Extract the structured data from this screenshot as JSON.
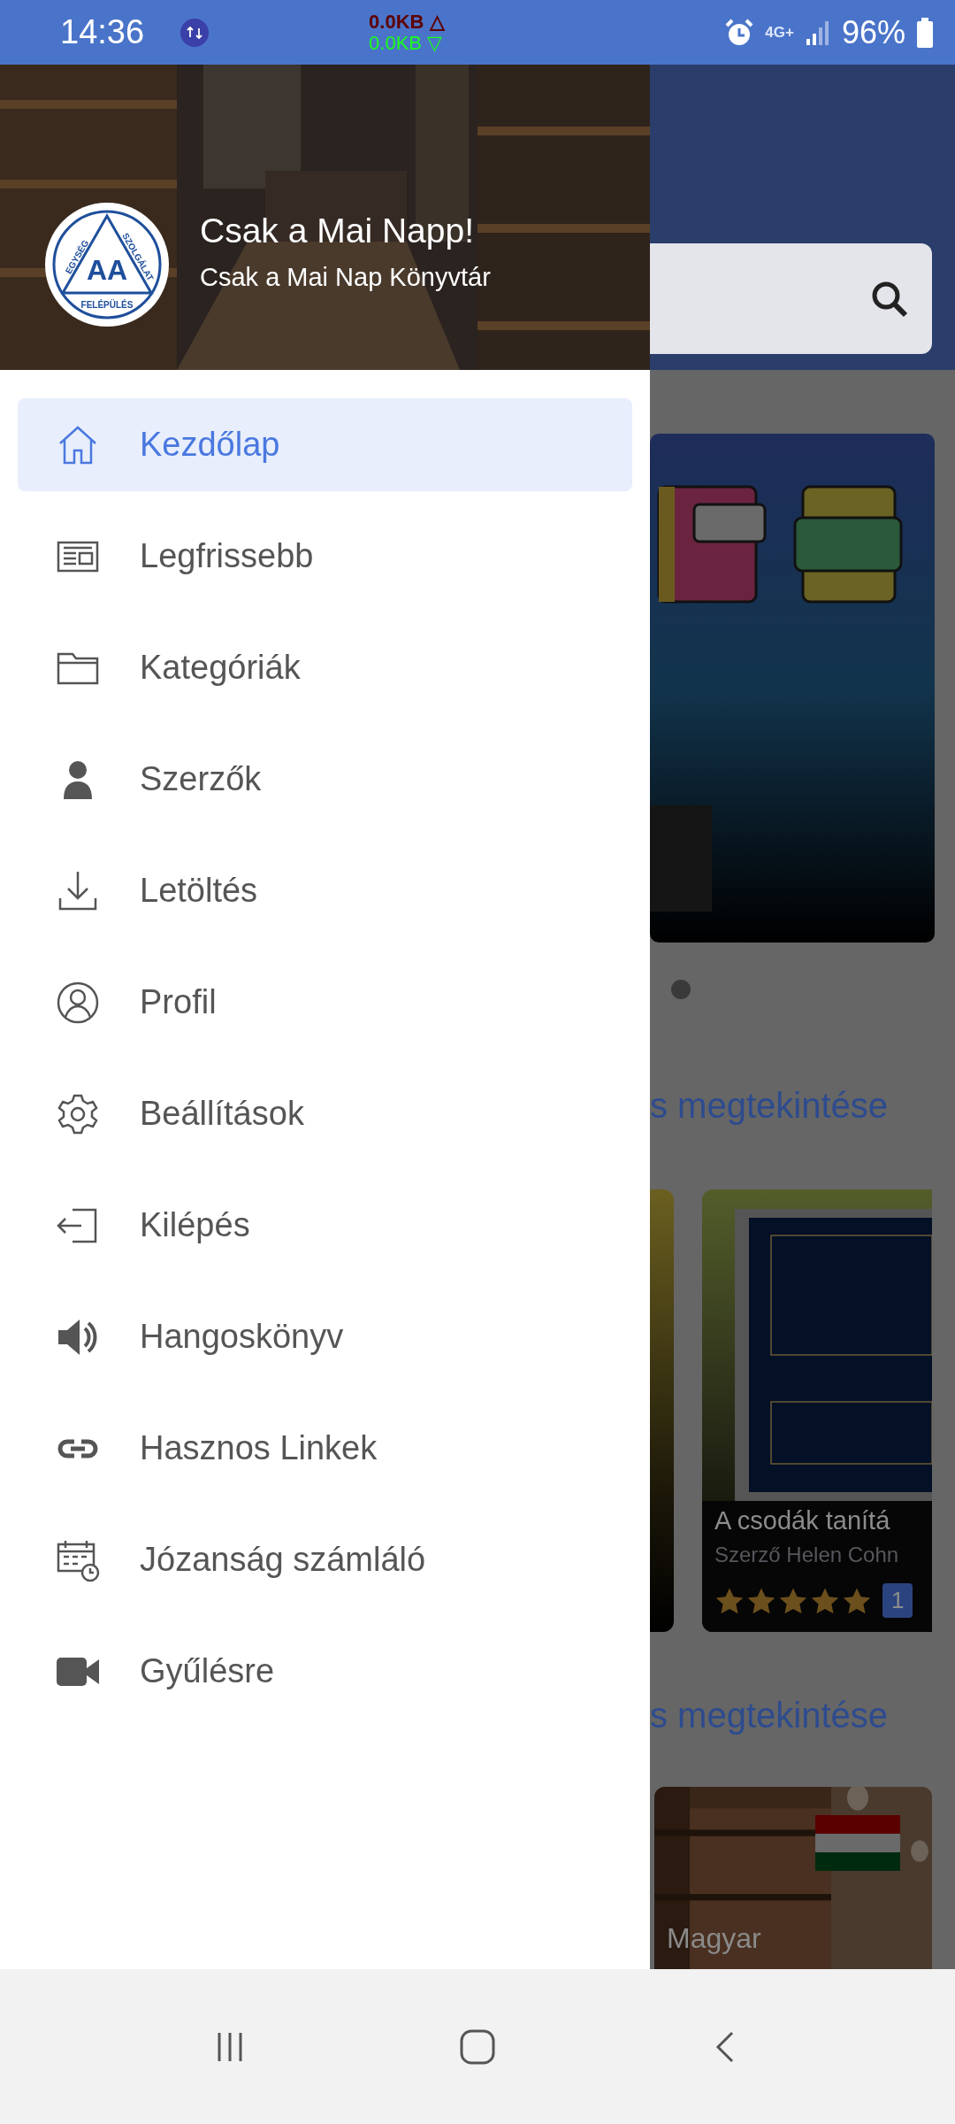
{
  "status_bar": {
    "time": "14:36",
    "upload": "0.0KB △",
    "download": "0.0KB ▽",
    "network": "4G+",
    "battery": "96%"
  },
  "drawer": {
    "header": {
      "title": "Csak a Mai Napp!",
      "subtitle": "Csak a Mai Nap Könyvtár",
      "logo": {
        "letters": "AA",
        "left": "EGYSÉG",
        "right": "SZOLGÁLAT",
        "bottom": "FELÉPÜLÉS"
      }
    },
    "items": [
      {
        "label": "Kezdőlap",
        "selected": true
      },
      {
        "label": "Legfrissebb",
        "selected": false
      },
      {
        "label": "Kategóriák",
        "selected": false
      },
      {
        "label": "Szerzők",
        "selected": false
      },
      {
        "label": "Letöltés",
        "selected": false
      },
      {
        "label": "Profil",
        "selected": false
      },
      {
        "label": "Beállítások",
        "selected": false
      },
      {
        "label": "Kilépés",
        "selected": false
      },
      {
        "label": "Hangoskönyv",
        "selected": false
      },
      {
        "label": "Hasznos Linkek",
        "selected": false
      },
      {
        "label": "Józanság számláló",
        "selected": false
      },
      {
        "label": "Gyűlésre",
        "selected": false
      }
    ]
  },
  "background": {
    "section_links": [
      "s megtekintése",
      "s megtekintése"
    ],
    "book_card": {
      "title": "A csodák tanítá",
      "author": "Szerző Helen Cohn",
      "stars": 5,
      "badge": "1"
    },
    "category_card": {
      "label": "Magyar"
    }
  }
}
